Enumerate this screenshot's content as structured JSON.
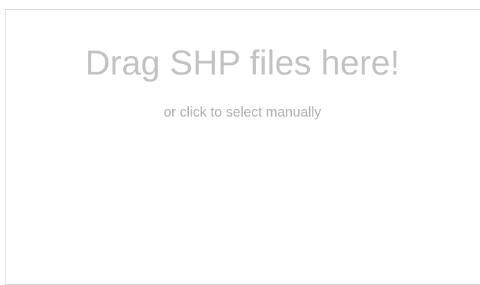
{
  "dropzone": {
    "title": "Drag SHP files here!",
    "subtitle": "or click to select manually"
  },
  "colors": {
    "border": "#cfcfcf",
    "title": "#c2c2c2",
    "subtitle": "#aeaeae",
    "background": "#ffffff"
  }
}
